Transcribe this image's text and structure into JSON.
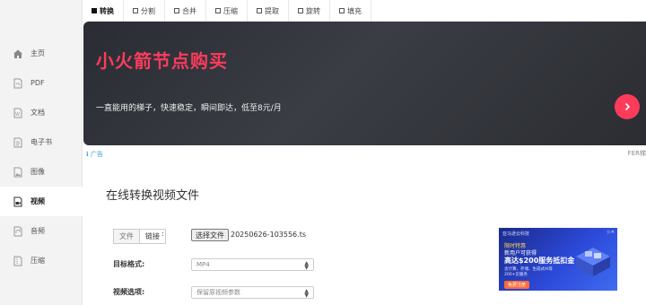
{
  "sidebar": {
    "items": [
      {
        "label": "主页",
        "icon": "home-icon"
      },
      {
        "label": "PDF",
        "icon": "pdf-icon"
      },
      {
        "label": "文档",
        "icon": "word-icon"
      },
      {
        "label": "电子书",
        "icon": "ebook-icon"
      },
      {
        "label": "图像",
        "icon": "image-icon"
      },
      {
        "label": "视频",
        "icon": "video-icon",
        "active": true
      },
      {
        "label": "音频",
        "icon": "audio-icon"
      },
      {
        "label": "压缩",
        "icon": "archive-icon"
      }
    ]
  },
  "tabs": [
    {
      "label": "转换",
      "active": true
    },
    {
      "label": "分割"
    },
    {
      "label": "合并"
    },
    {
      "label": "压缩"
    },
    {
      "label": "提取"
    },
    {
      "label": "旋转"
    },
    {
      "label": "填充"
    }
  ],
  "banner": {
    "title": "小火箭节点购买",
    "subtitle": "一直能用的梯子，快速稳定，瞬间即达，低至8元/月",
    "accent": "#ff3b5c"
  },
  "ad_label": "广告",
  "ad_right": "FER梯",
  "main": {
    "title": "在线转换视频文件",
    "source_tabs": [
      "文件",
      "链接"
    ],
    "colon": ":",
    "choose_file": "选择文件",
    "file_name": "20250626-103556.ts",
    "target_label": "目标格式:",
    "target_value": "MP4",
    "options_label": "视频选项:",
    "options_value": "保留原视频参数"
  },
  "side_ad": {
    "top": "亚马逊云科技",
    "line1": "限时特惠",
    "line2": "新用户可获得",
    "line3": "高达$200服务抵扣金",
    "line4": "含计算、存储、生成式AI等200+云服务",
    "cta": "免费注册"
  }
}
